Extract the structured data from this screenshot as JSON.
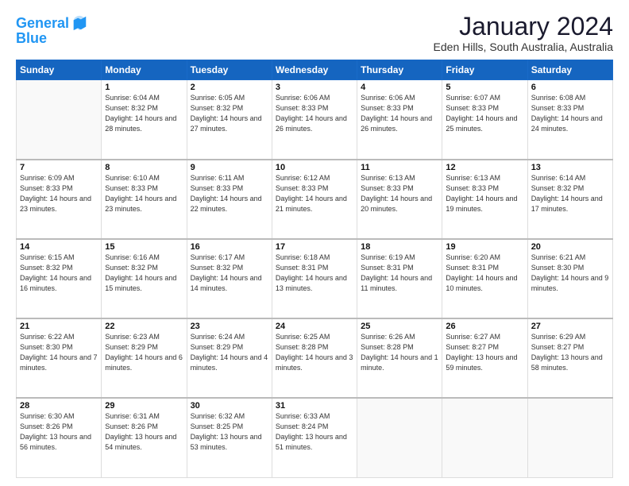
{
  "logo": {
    "line1": "General",
    "line2": "Blue"
  },
  "title": "January 2024",
  "subtitle": "Eden Hills, South Australia, Australia",
  "weekdays": [
    "Sunday",
    "Monday",
    "Tuesday",
    "Wednesday",
    "Thursday",
    "Friday",
    "Saturday"
  ],
  "weeks": [
    [
      {
        "day": "",
        "sunrise": "",
        "sunset": "",
        "daylight": ""
      },
      {
        "day": "1",
        "sunrise": "Sunrise: 6:04 AM",
        "sunset": "Sunset: 8:32 PM",
        "daylight": "Daylight: 14 hours and 28 minutes."
      },
      {
        "day": "2",
        "sunrise": "Sunrise: 6:05 AM",
        "sunset": "Sunset: 8:32 PM",
        "daylight": "Daylight: 14 hours and 27 minutes."
      },
      {
        "day": "3",
        "sunrise": "Sunrise: 6:06 AM",
        "sunset": "Sunset: 8:33 PM",
        "daylight": "Daylight: 14 hours and 26 minutes."
      },
      {
        "day": "4",
        "sunrise": "Sunrise: 6:06 AM",
        "sunset": "Sunset: 8:33 PM",
        "daylight": "Daylight: 14 hours and 26 minutes."
      },
      {
        "day": "5",
        "sunrise": "Sunrise: 6:07 AM",
        "sunset": "Sunset: 8:33 PM",
        "daylight": "Daylight: 14 hours and 25 minutes."
      },
      {
        "day": "6",
        "sunrise": "Sunrise: 6:08 AM",
        "sunset": "Sunset: 8:33 PM",
        "daylight": "Daylight: 14 hours and 24 minutes."
      }
    ],
    [
      {
        "day": "7",
        "sunrise": "Sunrise: 6:09 AM",
        "sunset": "Sunset: 8:33 PM",
        "daylight": "Daylight: 14 hours and 23 minutes."
      },
      {
        "day": "8",
        "sunrise": "Sunrise: 6:10 AM",
        "sunset": "Sunset: 8:33 PM",
        "daylight": "Daylight: 14 hours and 23 minutes."
      },
      {
        "day": "9",
        "sunrise": "Sunrise: 6:11 AM",
        "sunset": "Sunset: 8:33 PM",
        "daylight": "Daylight: 14 hours and 22 minutes."
      },
      {
        "day": "10",
        "sunrise": "Sunrise: 6:12 AM",
        "sunset": "Sunset: 8:33 PM",
        "daylight": "Daylight: 14 hours and 21 minutes."
      },
      {
        "day": "11",
        "sunrise": "Sunrise: 6:13 AM",
        "sunset": "Sunset: 8:33 PM",
        "daylight": "Daylight: 14 hours and 20 minutes."
      },
      {
        "day": "12",
        "sunrise": "Sunrise: 6:13 AM",
        "sunset": "Sunset: 8:33 PM",
        "daylight": "Daylight: 14 hours and 19 minutes."
      },
      {
        "day": "13",
        "sunrise": "Sunrise: 6:14 AM",
        "sunset": "Sunset: 8:32 PM",
        "daylight": "Daylight: 14 hours and 17 minutes."
      }
    ],
    [
      {
        "day": "14",
        "sunrise": "Sunrise: 6:15 AM",
        "sunset": "Sunset: 8:32 PM",
        "daylight": "Daylight: 14 hours and 16 minutes."
      },
      {
        "day": "15",
        "sunrise": "Sunrise: 6:16 AM",
        "sunset": "Sunset: 8:32 PM",
        "daylight": "Daylight: 14 hours and 15 minutes."
      },
      {
        "day": "16",
        "sunrise": "Sunrise: 6:17 AM",
        "sunset": "Sunset: 8:32 PM",
        "daylight": "Daylight: 14 hours and 14 minutes."
      },
      {
        "day": "17",
        "sunrise": "Sunrise: 6:18 AM",
        "sunset": "Sunset: 8:31 PM",
        "daylight": "Daylight: 14 hours and 13 minutes."
      },
      {
        "day": "18",
        "sunrise": "Sunrise: 6:19 AM",
        "sunset": "Sunset: 8:31 PM",
        "daylight": "Daylight: 14 hours and 11 minutes."
      },
      {
        "day": "19",
        "sunrise": "Sunrise: 6:20 AM",
        "sunset": "Sunset: 8:31 PM",
        "daylight": "Daylight: 14 hours and 10 minutes."
      },
      {
        "day": "20",
        "sunrise": "Sunrise: 6:21 AM",
        "sunset": "Sunset: 8:30 PM",
        "daylight": "Daylight: 14 hours and 9 minutes."
      }
    ],
    [
      {
        "day": "21",
        "sunrise": "Sunrise: 6:22 AM",
        "sunset": "Sunset: 8:30 PM",
        "daylight": "Daylight: 14 hours and 7 minutes."
      },
      {
        "day": "22",
        "sunrise": "Sunrise: 6:23 AM",
        "sunset": "Sunset: 8:29 PM",
        "daylight": "Daylight: 14 hours and 6 minutes."
      },
      {
        "day": "23",
        "sunrise": "Sunrise: 6:24 AM",
        "sunset": "Sunset: 8:29 PM",
        "daylight": "Daylight: 14 hours and 4 minutes."
      },
      {
        "day": "24",
        "sunrise": "Sunrise: 6:25 AM",
        "sunset": "Sunset: 8:28 PM",
        "daylight": "Daylight: 14 hours and 3 minutes."
      },
      {
        "day": "25",
        "sunrise": "Sunrise: 6:26 AM",
        "sunset": "Sunset: 8:28 PM",
        "daylight": "Daylight: 14 hours and 1 minute."
      },
      {
        "day": "26",
        "sunrise": "Sunrise: 6:27 AM",
        "sunset": "Sunset: 8:27 PM",
        "daylight": "Daylight: 13 hours and 59 minutes."
      },
      {
        "day": "27",
        "sunrise": "Sunrise: 6:29 AM",
        "sunset": "Sunset: 8:27 PM",
        "daylight": "Daylight: 13 hours and 58 minutes."
      }
    ],
    [
      {
        "day": "28",
        "sunrise": "Sunrise: 6:30 AM",
        "sunset": "Sunset: 8:26 PM",
        "daylight": "Daylight: 13 hours and 56 minutes."
      },
      {
        "day": "29",
        "sunrise": "Sunrise: 6:31 AM",
        "sunset": "Sunset: 8:26 PM",
        "daylight": "Daylight: 13 hours and 54 minutes."
      },
      {
        "day": "30",
        "sunrise": "Sunrise: 6:32 AM",
        "sunset": "Sunset: 8:25 PM",
        "daylight": "Daylight: 13 hours and 53 minutes."
      },
      {
        "day": "31",
        "sunrise": "Sunrise: 6:33 AM",
        "sunset": "Sunset: 8:24 PM",
        "daylight": "Daylight: 13 hours and 51 minutes."
      },
      {
        "day": "",
        "sunrise": "",
        "sunset": "",
        "daylight": ""
      },
      {
        "day": "",
        "sunrise": "",
        "sunset": "",
        "daylight": ""
      },
      {
        "day": "",
        "sunrise": "",
        "sunset": "",
        "daylight": ""
      }
    ]
  ]
}
